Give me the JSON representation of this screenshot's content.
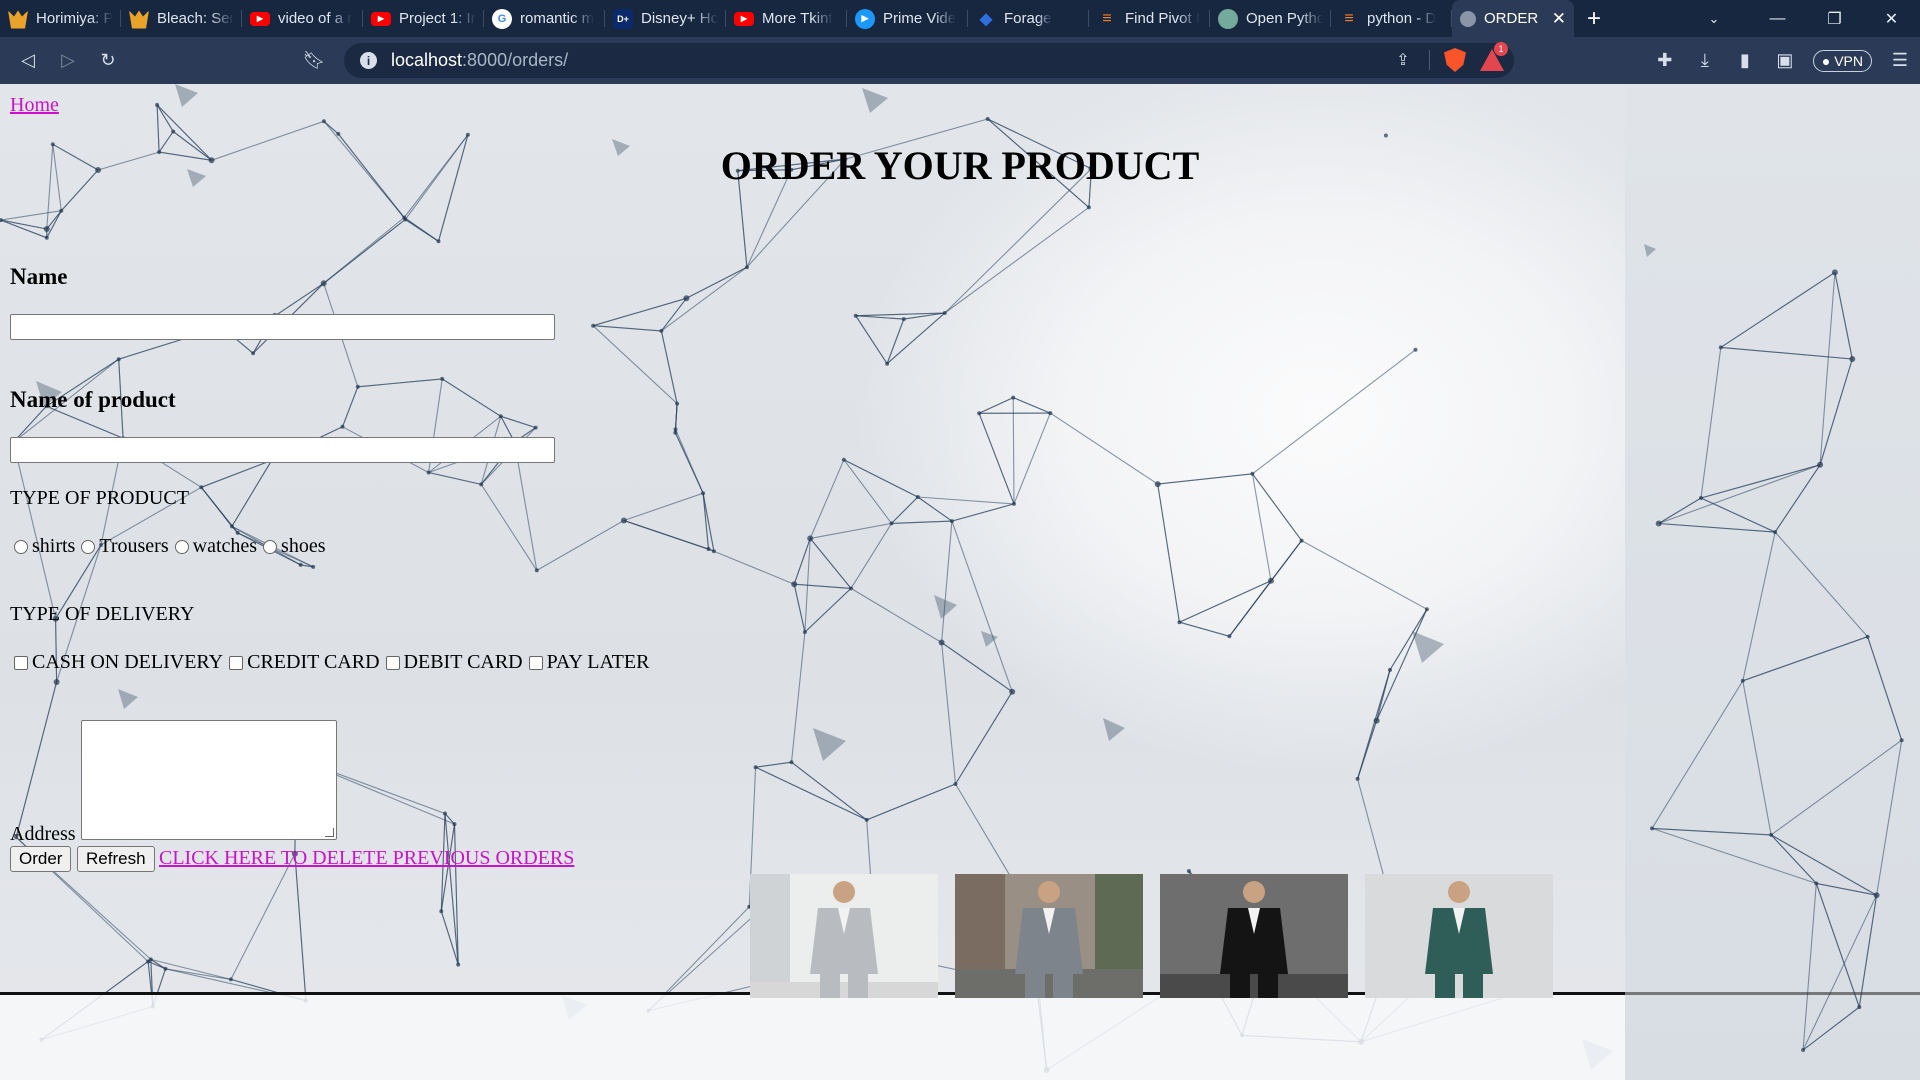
{
  "browser": {
    "tabs": [
      {
        "label": "Horimiya: P",
        "icon": "anime-icon",
        "color": "#e9a32a"
      },
      {
        "label": "Bleach: Sen",
        "icon": "anime-icon",
        "color": "#e9a32a"
      },
      {
        "label": "video of a r",
        "icon": "youtube-icon",
        "color": "#ff0000"
      },
      {
        "label": "Project 1: Ir",
        "icon": "youtube-icon",
        "color": "#ff0000"
      },
      {
        "label": "romantic m",
        "icon": "google-icon",
        "color": "#ffffff"
      },
      {
        "label": "Disney+ Hc",
        "icon": "disney-icon",
        "color": "#0b2a6b"
      },
      {
        "label": "More Tkint",
        "icon": "youtube-icon",
        "color": "#ff0000"
      },
      {
        "label": "Prime Vide",
        "icon": "prime-icon",
        "color": "#1a98ff"
      },
      {
        "label": "Forage",
        "icon": "forage-icon",
        "color": "#2f6fe0"
      },
      {
        "label": "Find Pivot I",
        "icon": "stackoverflow-icon",
        "color": "#f48024"
      },
      {
        "label": "Open Pytho",
        "icon": "openai-icon",
        "color": "#74aa9c"
      },
      {
        "label": "python - D",
        "icon": "stackoverflow-icon",
        "color": "#f48024"
      }
    ],
    "active_tab": {
      "label": "ORDER",
      "icon": "globe-icon"
    },
    "url_host": "localhost",
    "url_path": ":8000/orders/",
    "vpn_label": "VPN",
    "notification_count": "1"
  },
  "page": {
    "home_link": "Home",
    "title": "ORDER YOUR PRODUCT",
    "name_label": "Name",
    "product_name_label": "Name of product",
    "product_type_label": "TYPE OF PRODUCT",
    "product_types": [
      "shirts",
      "Trousers",
      "watches",
      "shoes"
    ],
    "delivery_label": "TYPE OF DELIVERY",
    "delivery_options": [
      "CASH ON DELIVERY",
      "CREDIT CARD",
      "DEBIT CARD",
      "PAY LATER"
    ],
    "address_label": "Address",
    "order_button": "Order",
    "refresh_button": "Refresh",
    "delete_link": "CLICK HERE TO DELETE PREVIOUS ORDERS"
  },
  "photos": [
    {
      "name": "grey-suit-man-photo",
      "suit": "#b8bcc0"
    },
    {
      "name": "grey-suit-street-photo",
      "suit": "#7d848c"
    },
    {
      "name": "black-suit-man-photo",
      "suit": "#141414"
    },
    {
      "name": "teal-suit-man-photo",
      "suit": "#2f5d57"
    }
  ],
  "colors": {
    "link": "#cc11cc",
    "chrome_dark": "#172740",
    "chrome_toolbar": "#2b3b57"
  }
}
